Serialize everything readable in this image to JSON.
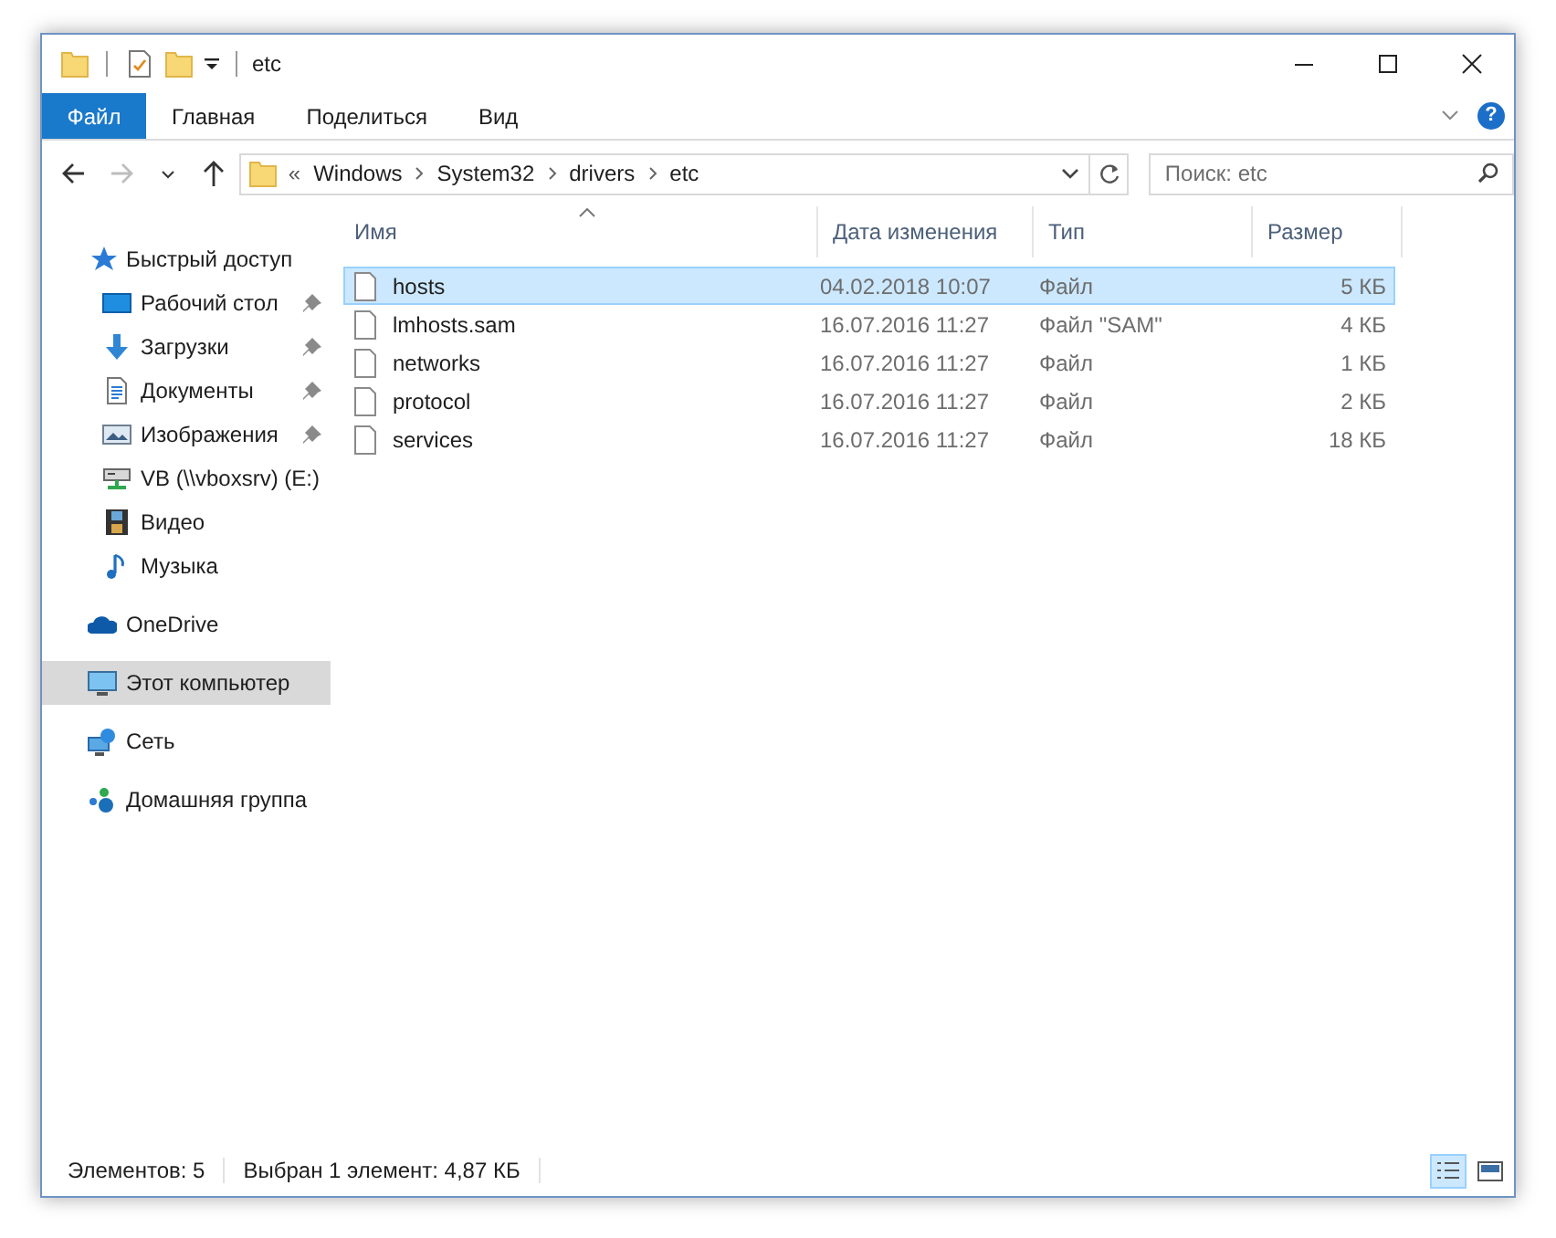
{
  "window": {
    "title": "etc"
  },
  "ribbon": {
    "tabs": [
      {
        "label": "Файл",
        "kind": "file"
      },
      {
        "label": "Главная",
        "kind": "tab"
      },
      {
        "label": "Поделиться",
        "kind": "tab"
      },
      {
        "label": "Вид",
        "kind": "tab"
      }
    ],
    "help": "?"
  },
  "navigation": [
    {
      "kind": "back",
      "disabled": false
    },
    {
      "kind": "forward",
      "disabled": true
    },
    {
      "kind": "recent",
      "disabled": false
    },
    {
      "kind": "up",
      "disabled": false
    }
  ],
  "address": {
    "overflow": "«",
    "segments": [
      "Windows",
      "System32",
      "drivers",
      "etc"
    ]
  },
  "search": {
    "placeholder": "Поиск: etc"
  },
  "sidebar": {
    "items": [
      {
        "label": "Быстрый доступ",
        "kind": "star",
        "selected": false,
        "children": [
          {
            "label": "Рабочий стол",
            "kind": "desktop",
            "pinned": true,
            "selected": false
          },
          {
            "label": "Загрузки",
            "kind": "download",
            "pinned": true,
            "selected": false
          },
          {
            "label": "Документы",
            "kind": "documents",
            "pinned": true,
            "selected": false
          },
          {
            "label": "Изображения",
            "kind": "pictures",
            "pinned": true,
            "selected": false
          },
          {
            "label": "VB (\\\\vboxsrv) (E:)",
            "kind": "drive",
            "pinned": false,
            "selected": false
          },
          {
            "label": "Видео",
            "kind": "video",
            "pinned": false,
            "selected": false
          },
          {
            "label": "Музыка",
            "kind": "music",
            "pinned": false,
            "selected": false
          }
        ]
      },
      {
        "label": "OneDrive",
        "kind": "onedrive",
        "selected": false
      },
      {
        "label": "Этот компьютер",
        "kind": "computer",
        "selected": true
      },
      {
        "label": "Сеть",
        "kind": "network",
        "selected": false
      },
      {
        "label": "Домашняя группа",
        "kind": "homegroup",
        "selected": false
      }
    ]
  },
  "files": {
    "columns": [
      {
        "label": "Имя",
        "sorted": true
      },
      {
        "label": "Дата изменения",
        "sorted": false
      },
      {
        "label": "Тип",
        "sorted": false
      },
      {
        "label": "Размер",
        "sorted": false
      }
    ],
    "rows": [
      {
        "name": "hosts",
        "date": "04.02.2018 10:07",
        "type": "Файл",
        "size": "5 КБ",
        "selected": true
      },
      {
        "name": "lmhosts.sam",
        "date": "16.07.2016 11:27",
        "type": "Файл \"SAM\"",
        "size": "4 КБ",
        "selected": false
      },
      {
        "name": "networks",
        "date": "16.07.2016 11:27",
        "type": "Файл",
        "size": "1 КБ",
        "selected": false
      },
      {
        "name": "protocol",
        "date": "16.07.2016 11:27",
        "type": "Файл",
        "size": "2 КБ",
        "selected": false
      },
      {
        "name": "services",
        "date": "16.07.2016 11:27",
        "type": "Файл",
        "size": "18 КБ",
        "selected": false
      }
    ]
  },
  "status_bar": {
    "items_count": "Элементов: 5",
    "selection": "Выбран 1 элемент: 4,87 КБ",
    "views": [
      {
        "kind": "details",
        "selected": true
      },
      {
        "kind": "large_icons",
        "selected": false
      }
    ]
  }
}
